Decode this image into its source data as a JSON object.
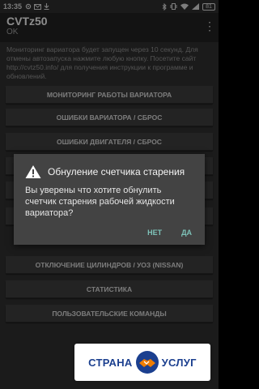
{
  "statusbar": {
    "time": "13:35",
    "battery": "81",
    "left_icons": [
      "settings-icon",
      "mail-icon",
      "download-icon"
    ],
    "right_icons": [
      "bluetooth-icon",
      "vibrate-icon",
      "wifi-icon",
      "signal-icon"
    ]
  },
  "appbar": {
    "title": "CVTz50",
    "subtitle": "OK",
    "menu_icon": "⋮"
  },
  "info_text": "Мониторинг вариатора будет запущен через 10 секунд. Для отмены автозапуска нажмите любую кнопку. Посетите сайт http://cvtz50.info/ для получения инструкции к программе и обновлений.",
  "buttons": [
    {
      "label": "МОНИТОРИНГ РАБОТЫ ВАРИАТОРА"
    },
    {
      "label": "ОШИБКИ ВАРИАТОРА / СБРОС"
    },
    {
      "label": "ОШИБКИ ДВИГАТЕЛЯ / СБРОС"
    },
    {
      "label": ""
    },
    {
      "label": ""
    },
    {
      "label": ""
    },
    {
      "label": "ОТКЛЮЧЕНИЕ ЦИЛИНДРОВ / УОЗ (NISSAN)"
    },
    {
      "label": "СТАТИСТИКА"
    },
    {
      "label": "ПОЛЬЗОВАТЕЛЬСКИЕ КОМАНДЫ"
    }
  ],
  "dialog": {
    "title": "Обнуление счетчика старения",
    "message": "Вы уверены что хотите обнулить счетчик старения рабочей жидкости вариатора?",
    "negative": "НЕТ",
    "positive": "ДА",
    "icon": "warning-icon"
  },
  "banner": {
    "word_left": "СТРАНА",
    "word_right": "УСЛУГ",
    "icon": "handshake-icon",
    "colors": {
      "text": "#1b3f8f",
      "accent": "#f07d00"
    }
  }
}
